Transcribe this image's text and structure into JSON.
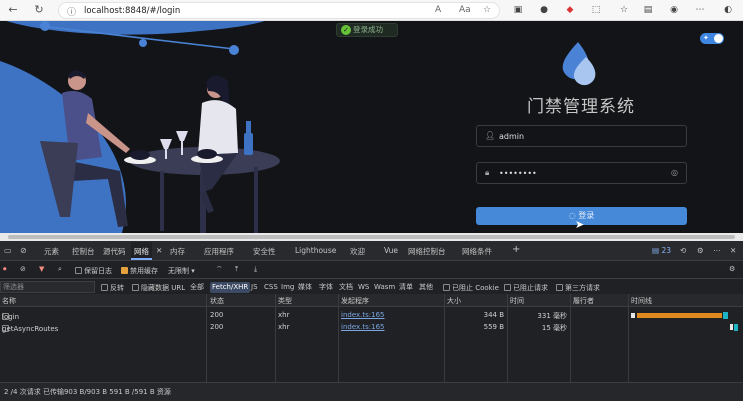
{
  "browser": {
    "url": "localhost:8848/#/login"
  },
  "page": {
    "toast": "登录成功",
    "system_title": "门禁管理系统",
    "username_value": "admin",
    "password_value": "••••••••",
    "login_button": "登录"
  },
  "devtools": {
    "tabs": [
      "元素",
      "控制台",
      "源代码",
      "网络",
      "内存",
      "应用程序",
      "安全性",
      "Lighthouse",
      "欢迎",
      "Vue",
      "网络控制台",
      "网络条件"
    ],
    "active_tab": "网络",
    "badge_count": "23",
    "toolbar": {
      "preserve_log": "保留日志",
      "disable_cache": "禁用缓存",
      "throttle": "无限制"
    },
    "filter_placeholder": "筛选器",
    "filters": {
      "invert": "反转",
      "hide_data_urls": "隐藏数据 URL",
      "all": "全部",
      "types": [
        "Fetch/XHR",
        "JS",
        "CSS",
        "Img",
        "媒体",
        "字体",
        "文档",
        "WS",
        "Wasm",
        "清单",
        "其他"
      ],
      "blocked_cookies": "已阻止 Cookie",
      "blocked_requests": "已阻止请求",
      "third_party": "第三方请求"
    },
    "columns": [
      "名称",
      "状态",
      "类型",
      "发起程序",
      "大小",
      "时间",
      "履行者",
      "时间线"
    ],
    "rows": [
      {
        "name": "login",
        "status": "200",
        "type": "xhr",
        "initiator": "index.ts:165",
        "size": "344 B",
        "time": "331 毫秒"
      },
      {
        "name": "getAsyncRoutes",
        "status": "200",
        "type": "xhr",
        "initiator": "index.ts:165",
        "size": "559 B",
        "time": "15 毫秒"
      }
    ],
    "status_bar": "2 /4 次请求  已传输903 B/903 B  591 B /591 B 资源"
  }
}
